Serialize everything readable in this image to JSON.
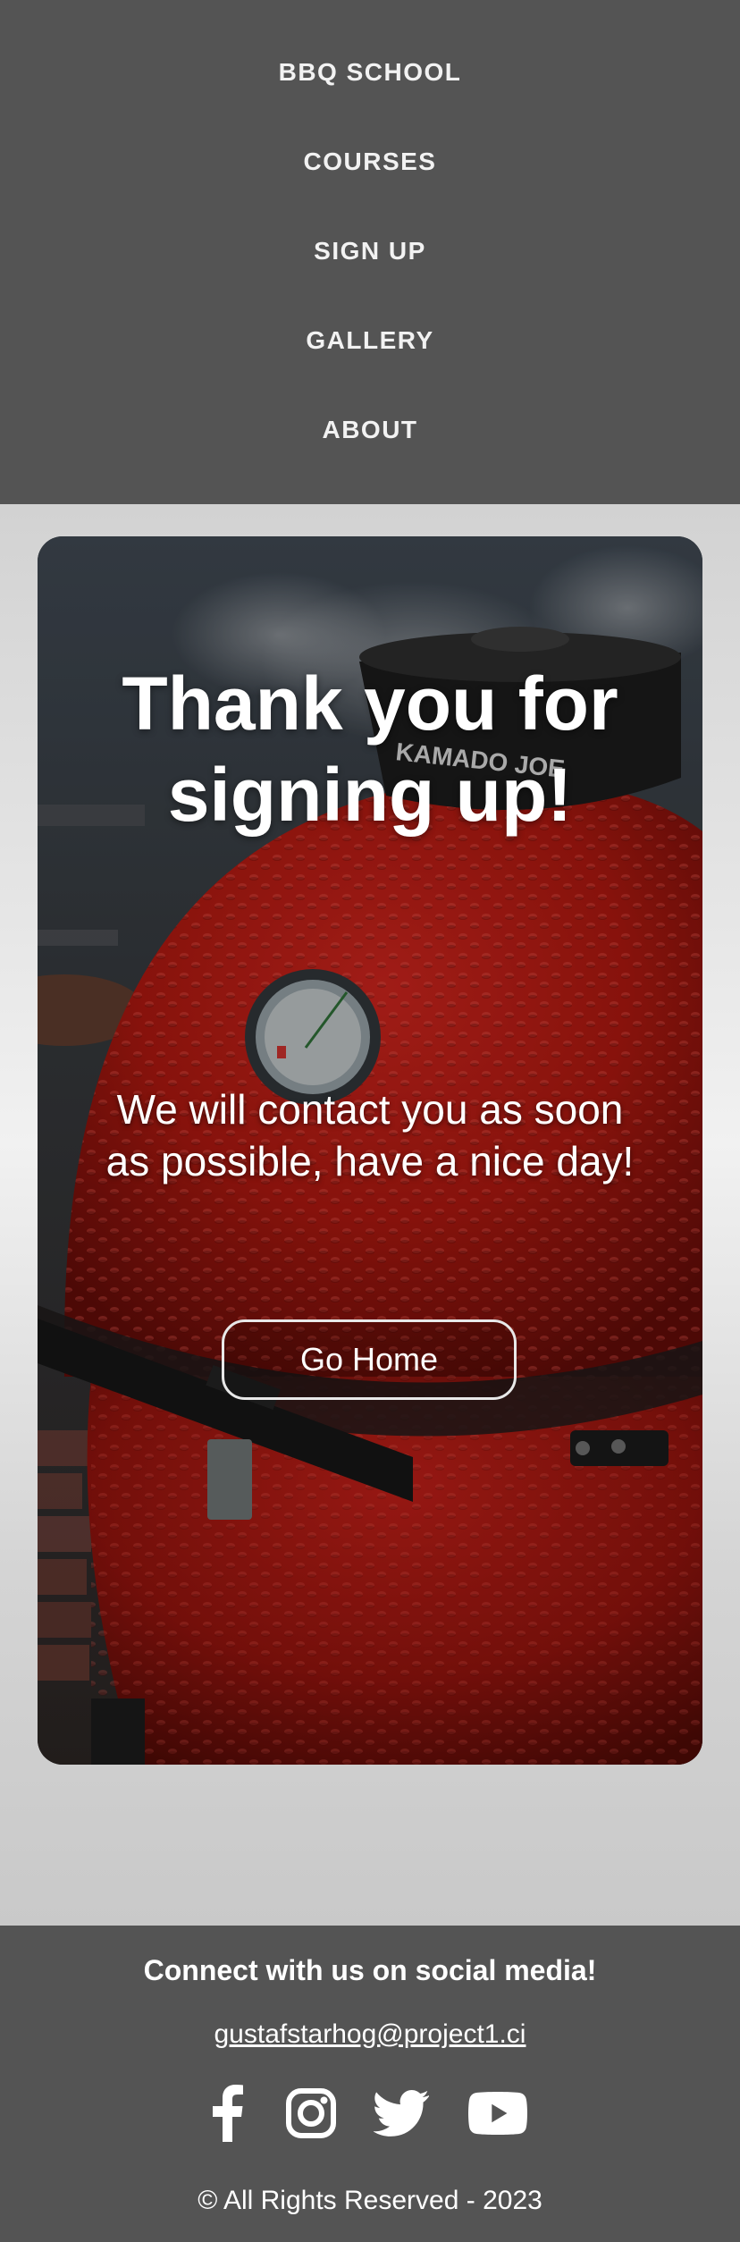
{
  "nav": {
    "items": [
      {
        "label": "BBQ SCHOOL"
      },
      {
        "label": "COURSES"
      },
      {
        "label": "SIGN UP"
      },
      {
        "label": "GALLERY"
      },
      {
        "label": "ABOUT"
      }
    ]
  },
  "confirmation": {
    "title_line1": "Thank you for",
    "title_line2": "signing up!",
    "message_line1": "We will contact you as soon",
    "message_line2": "as possible, have a nice day!",
    "button_label": "Go Home",
    "photo_grill_brand_text": "KAMADO JOE"
  },
  "footer": {
    "heading": "Connect with us on social media!",
    "email": "gustafstarhog@project1.ci",
    "social_icons": [
      "facebook-icon",
      "instagram-icon",
      "twitter-icon",
      "youtube-icon"
    ],
    "copyright": "© All Rights Reserved - 2023"
  },
  "colors": {
    "nav_background": "#545454",
    "footer_background": "#545454",
    "page_background": "#e6e6e6",
    "grill_red": "#b51a16",
    "text_light": "#ffffff"
  }
}
